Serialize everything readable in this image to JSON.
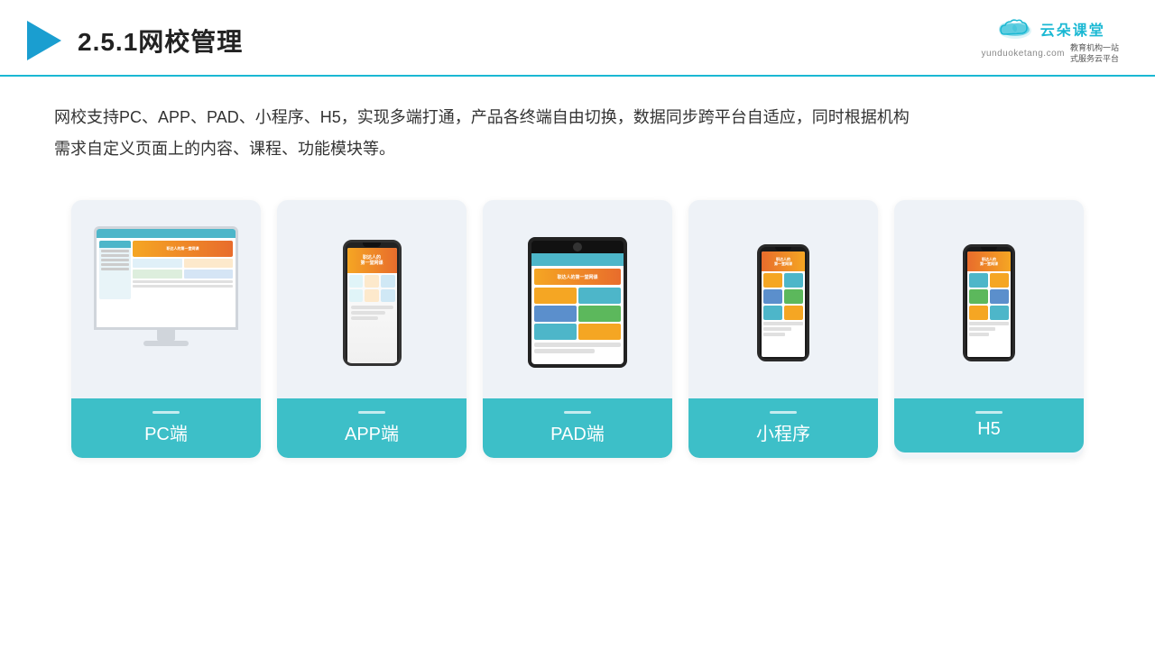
{
  "header": {
    "title": "2.5.1网校管理",
    "logo_text": "云朵课堂",
    "logo_url": "yunduoketang.com",
    "logo_tagline": "教育机构一站\n式服务云平台"
  },
  "description": {
    "text": "网校支持PC、APP、PAD、小程序、H5，实现多端打通，产品各终端自由切换，数据同步跨平台自适应，同时根据机构\n需求自定义页面上的内容、课程、功能模块等。"
  },
  "cards": [
    {
      "id": "pc",
      "label": "PC端"
    },
    {
      "id": "app",
      "label": "APP端"
    },
    {
      "id": "pad",
      "label": "PAD端"
    },
    {
      "id": "miniprogram",
      "label": "小程序"
    },
    {
      "id": "h5",
      "label": "H5"
    }
  ]
}
